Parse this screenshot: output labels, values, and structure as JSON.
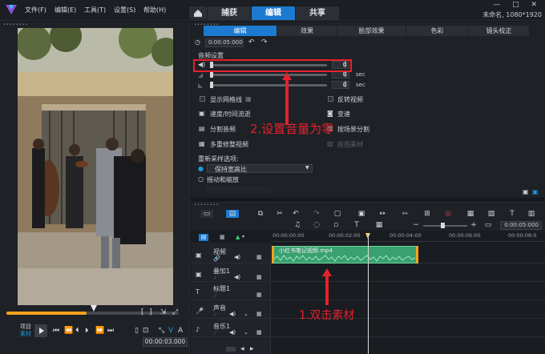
{
  "topbar": {
    "menu": [
      "文件(F)",
      "编辑(E)",
      "工具(T)",
      "设置(S)",
      "帮助(H)"
    ],
    "tabs": [
      "捕获",
      "编辑",
      "共享"
    ],
    "active_tab": "编辑",
    "project_info": "未命名, 1080*1920",
    "window_controls": "— □ ✕"
  },
  "preview": {
    "project_label": "项目",
    "clip_label": "素材",
    "timecode": "00:00:03.000",
    "playback_buttons": [
      "⏮",
      "⏪",
      "⏴",
      "⏵",
      "⏩",
      "⏭"
    ]
  },
  "options": {
    "tabs": [
      "编辑",
      "效果",
      "脸部效果",
      "色彩",
      "镜头校正"
    ],
    "active_tab": "编辑",
    "duration": "0:00:05:000",
    "audio_settings_label": "音频设置",
    "volume_value": "0",
    "fade_in_value": "0",
    "fade_out_value": "0",
    "unit": "sec",
    "checkboxes": [
      "显示网格线",
      "反转视频"
    ],
    "actions_left": [
      "速度/时间流逝",
      "分割音频",
      "多重修整视频"
    ],
    "actions_right": [
      "变速",
      "按场景分割",
      "抠图素材"
    ],
    "resample_label": "重新采样选项:",
    "resample_option1": "保持宽高比",
    "resample_option2": "摇动和缩放"
  },
  "annotations": {
    "step2": "2.设置音量为零",
    "step1": "1.双击素材"
  },
  "timeline": {
    "ruler": [
      "00:00:00:00",
      "00:00:02:00",
      "00:00:04:00",
      "00:00:06:00",
      "00:00:08:0"
    ],
    "zoom_timecode": "0:00:05:000",
    "tracks": [
      "视频",
      "叠加1",
      "标题1",
      "声音",
      "音乐1"
    ],
    "clip_name": "小红书笔记视频.mp4"
  },
  "colors": {
    "accent": "#1c7bd0",
    "clip": "#3aa070",
    "highlight": "#e3222d",
    "scrub": "#ffa21a"
  }
}
